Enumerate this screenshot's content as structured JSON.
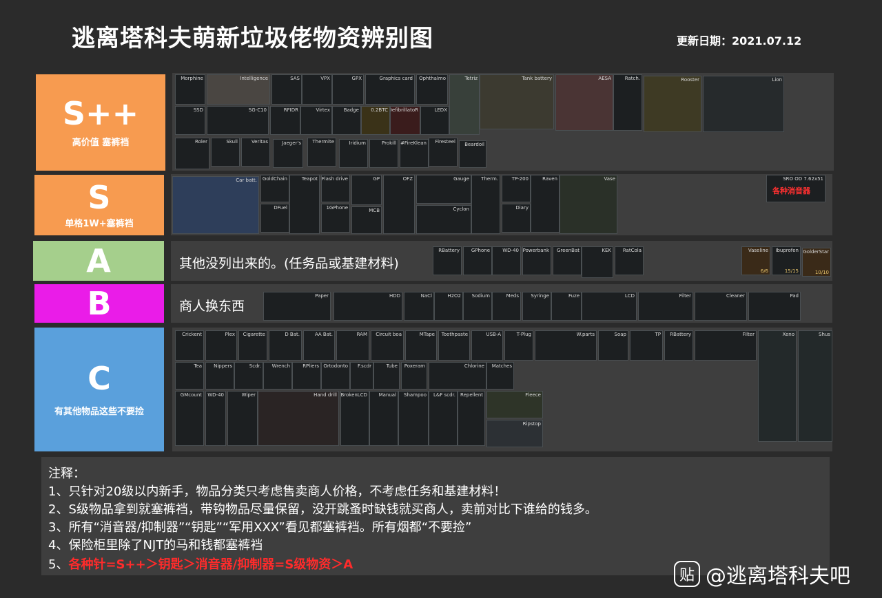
{
  "title": "逃离塔科夫萌新垃圾佬物资辨别图",
  "date": "更新日期：2021.07.12",
  "tiers": {
    "spp": {
      "label": "S++",
      "sub": "高价值 塞裤裆",
      "color": "#f79b50"
    },
    "s": {
      "label": "S",
      "sub": "单格1W+塞裤裆",
      "color": "#f79b50"
    },
    "a": {
      "label": "A",
      "sub": "",
      "color": "#a5cf8c"
    },
    "b": {
      "label": "B",
      "sub": "",
      "color": "#ea1ce8"
    },
    "c": {
      "label": "C",
      "sub": "有其他物品这些不要捡",
      "color": "#5aa0dc"
    }
  },
  "row_a_text": "其他没列出来的。(任务品或基建材料)",
  "row_b_text": "商人换东西",
  "items": {
    "spp": [
      "Morphine",
      "Intelligence",
      "SAS",
      "VPX",
      "GPX",
      "Graphics card",
      "Ophthalmo",
      "Tetriz",
      "Tank battery",
      "AESA",
      "Ratch.",
      "Rooster",
      "Lion",
      "SSD",
      "SG-C10",
      "RFIDR",
      "Virtex",
      "Badge",
      "0.2BTC",
      "DefibrillatoR",
      "LEDX",
      "Roler",
      "Skull",
      "Veritas",
      "Jaeger's",
      "Thermite",
      "Iridium",
      "Prokill",
      "#FireKlean",
      "Firesteel",
      "Beardoil"
    ],
    "s": [
      "Car batt.",
      "GoldChain",
      "Teapot",
      "Flash drive",
      "GP",
      "OFZ",
      "Gauge",
      "Therm.",
      "TP-200",
      "Raven",
      "Vase",
      "SRO OD 7.62x51",
      "DFuel",
      "1GPhone",
      "MCB",
      "Cyclon",
      "Diary",
      "各种消音器"
    ],
    "a": [
      "RBattery",
      "GPhone",
      "WD-40",
      "Powerbank",
      "GreenBat",
      "KEK",
      "RatCola",
      "Vaseline",
      "Ibuprofen",
      "GolderStar"
    ],
    "a_counts": [
      "6/6",
      "15/15",
      "10/10"
    ],
    "b": [
      "Paper",
      "HDD",
      "NaCl",
      "H2O2",
      "Sodium",
      "Meds",
      "Syringe",
      "Fuze",
      "LCD",
      "Filter",
      "Cleaner",
      "Pad"
    ],
    "c": [
      "Crickent",
      "Plex",
      "Cigarette",
      "D Bat.",
      "AA Bat.",
      "RAM",
      "Circuit boa",
      "MTape",
      "Toothpaste",
      "USB-A",
      "T-Plug",
      "W.parts",
      "Soap",
      "TP",
      "RBattery",
      "Filter",
      "Xeno",
      "Shus",
      "Tea",
      "Nippers",
      "Scdr.",
      "Wrench",
      "RPliers",
      "Ortodonto",
      "F.scdr",
      "Tube",
      "Poxeram",
      "Chlorine",
      "Matches",
      "GMcount",
      "WD-40",
      "Wiper",
      "Hand drill",
      "BrokenLCD",
      "Manual",
      "Shampoo",
      "L&F scdr.",
      "Repellent",
      "Fleece",
      "Ripstop"
    ]
  },
  "notes": {
    "head": "注释：",
    "n1": "1、只针对20级以内新手，物品分类只考虑售卖商人价格，不考虑任务和基建材料！",
    "n2": "2、S级物品拿到就塞裤裆，带钩物品尽量保留，没开跳蚤时缺钱就买商人，卖前对比下谁给的钱多。",
    "n3": "3、所有“消音器/抑制器”“钥匙”“军用XXX”看见都塞裤裆。所有烟都“不要捡”",
    "n4": "4、保险柜里除了NJT的马和钱都塞裤裆",
    "n5_prefix": "5、",
    "n5": "各种针=S++＞钥匙＞消音器/抑制器=S级物资＞A"
  },
  "watermark": {
    "logo": "贴",
    "text": "@逃离塔科夫吧"
  }
}
